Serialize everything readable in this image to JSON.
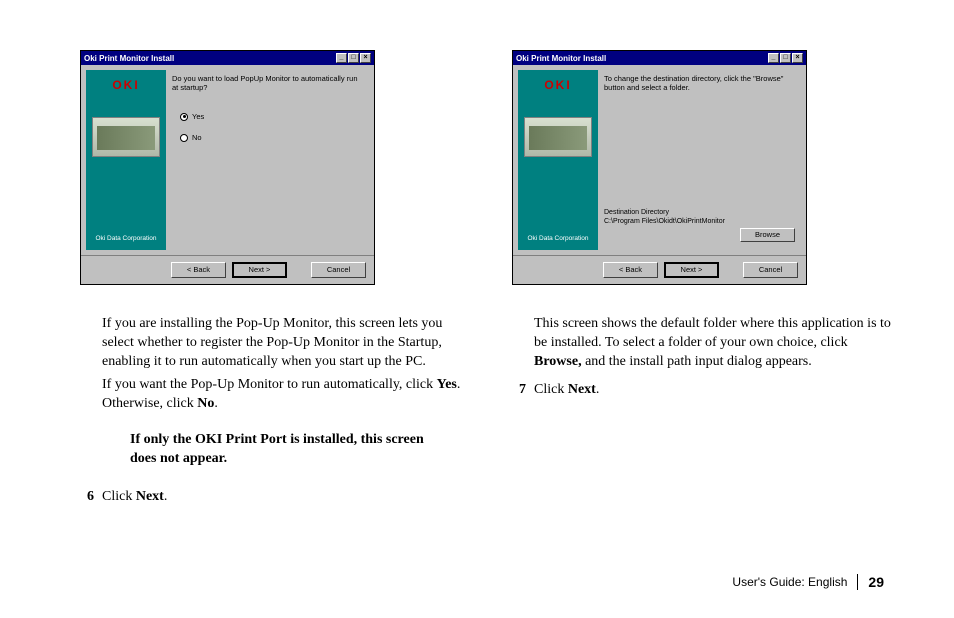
{
  "dialog1": {
    "title": "Oki Print Monitor Install",
    "logo": "OKI",
    "corp": "Oki Data Corporation",
    "prompt": "Do you want to load PopUp Monitor to automatically run at startup?",
    "opt_yes": "Yes",
    "opt_no": "No",
    "back": "< Back",
    "next": "Next >",
    "cancel": "Cancel"
  },
  "dialog2": {
    "title": "Oki Print Monitor Install",
    "logo": "OKI",
    "corp": "Oki Data Corporation",
    "prompt": "To change the destination directory, click the \"Browse\" button and select a folder.",
    "dest_label": "Destination Directory",
    "dest_path": "C:\\Program Files\\Okidt\\OkiPrintMonitor",
    "browse": "Browse",
    "back": "< Back",
    "next": "Next >",
    "cancel": "Cancel"
  },
  "col1": {
    "p1a": "If you are installing the Pop-Up Monitor, this screen lets you select whether to register the Pop-Up Monitor in the Startup, enabling it to run automatically when you start up the PC.",
    "p1b_pre": "If you want the Pop-Up Monitor to run automatically, click ",
    "p1b_yes": "Yes",
    "p1b_mid": ". Otherwise, click ",
    "p1b_no": "No",
    "p1b_post": ".",
    "note": "If only the OKI Print Port is installed, this screen does not appear.",
    "step6_num": "6",
    "step6_pre": "Click ",
    "step6_b": "Next",
    "step6_post": "."
  },
  "col2": {
    "p1_pre": "This screen shows the default folder where this application is to be installed.  To select a folder of your own choice, click ",
    "p1_b": "Browse,",
    "p1_post": " and the install path input dialog appears.",
    "step7_num": "7",
    "step7_pre": "Click ",
    "step7_b": "Next",
    "step7_post": "."
  },
  "footer": {
    "label": "User's Guide: English",
    "page": "29"
  }
}
